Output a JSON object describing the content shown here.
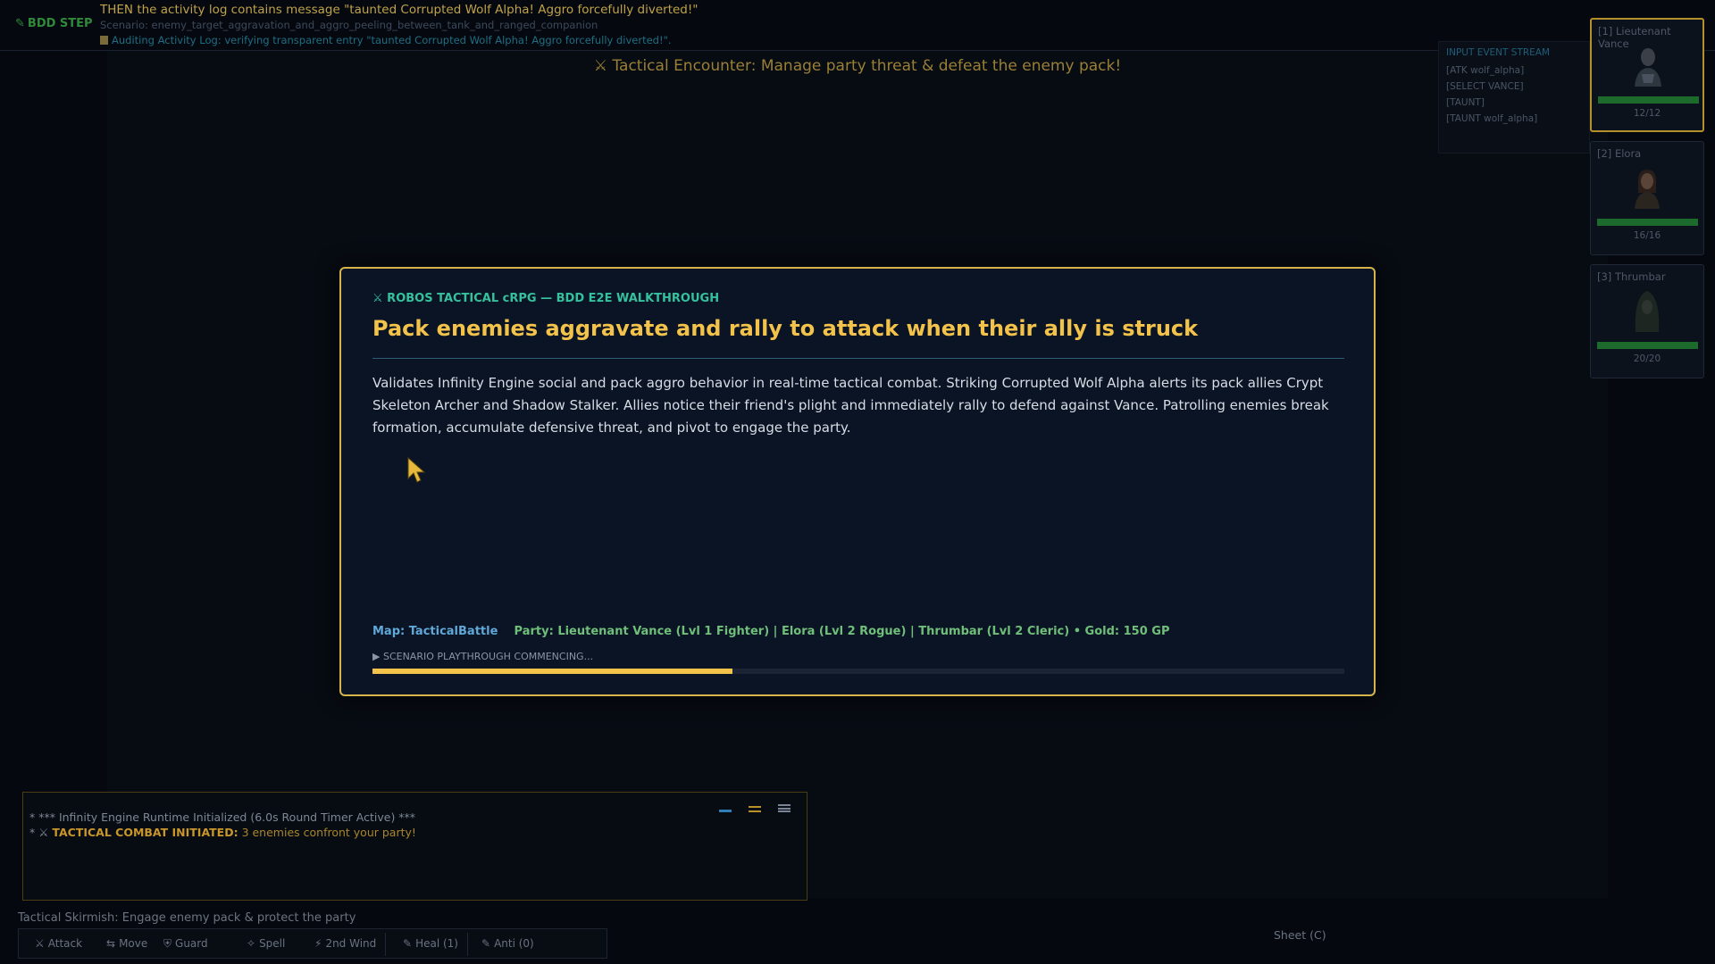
{
  "bdd": {
    "tag": "BDD STEP",
    "step": "THEN the activity log contains message \"taunted Corrupted Wolf Alpha! Aggro forcefully diverted!\"",
    "scenario": "Scenario: enemy_target_aggravation_and_aggro_peeling_between_tank_and_ranged_companion",
    "audit": "Auditing Activity Log: verifying transparent entry \"taunted Corrupted Wolf Alpha! Aggro forcefully diverted!\"."
  },
  "encounter_title": "⚔ Tactical Encounter: Manage party threat & defeat the enemy pack!",
  "input_stream": {
    "title": "INPUT EVENT STREAM",
    "events": [
      "[ATK wolf_alpha]",
      "[SELECT VANCE]",
      "[TAUNT]",
      "[TAUNT wolf_alpha]"
    ]
  },
  "party": [
    {
      "slot": "[1] Lieutenant Vance",
      "hp": "12/12",
      "hp_fraction": 1.0,
      "selected": true
    },
    {
      "slot": "[2] Elora",
      "hp": "16/16",
      "hp_fraction": 1.0,
      "selected": false
    },
    {
      "slot": "[3] Thrumbar",
      "hp": "20/20",
      "hp_fraction": 1.0,
      "selected": false
    }
  ],
  "modal": {
    "kicker": "⚔ ROBOS TACTICAL cRPG — BDD E2E WALKTHROUGH",
    "title": "Pack enemies aggravate and rally to attack when their ally is struck",
    "description": "Validates Infinity Engine social and pack aggro behavior in real-time tactical combat. Striking Corrupted Wolf Alpha alerts its pack allies Crypt Skeleton Archer and Shadow Stalker. Allies notice their friend's plight and immediately rally to defend against Vance. Patrolling enemies break formation, accumulate defensive threat, and pivot to engage the party.",
    "map": "Map: TacticalBattle",
    "party_summary": "Party: Lieutenant Vance (Lvl 1 Fighter) | Elora (Lvl 2 Rogue) | Thrumbar (Lvl 2 Cleric) • Gold: 150 GP",
    "status": "▶ SCENARIO PLAYTHROUGH COMMENCING...",
    "progress_fraction": 0.37
  },
  "combat_log": {
    "line1": "* *** Infinity Engine Runtime Initialized (6.0s Round Timer Active) ***",
    "line2_prefix": "* ⚔ ",
    "line2_highlight": "TACTICAL COMBAT INITIATED:",
    "line2_rest": " 3 enemies confront your party!"
  },
  "status_line": "Tactical Skirmish: Engage enemy pack & protect the party",
  "actions": [
    {
      "icon": "⚔",
      "label": "Attack"
    },
    {
      "icon": "⇆",
      "label": "Move"
    },
    {
      "icon": "⛨",
      "label": "Guard"
    },
    {
      "icon": "✧",
      "label": "Spell"
    },
    {
      "icon": "⚡",
      "label": "2nd Wind"
    },
    {
      "icon": "✎",
      "label": "Heal (1)"
    },
    {
      "icon": "✎",
      "label": "Anti (0)"
    }
  ],
  "sheet_label": "Sheet (C)",
  "colors": {
    "accent_gold": "#f2c24a",
    "hp_green": "#1d6b2c",
    "teal": "#35c19e"
  }
}
